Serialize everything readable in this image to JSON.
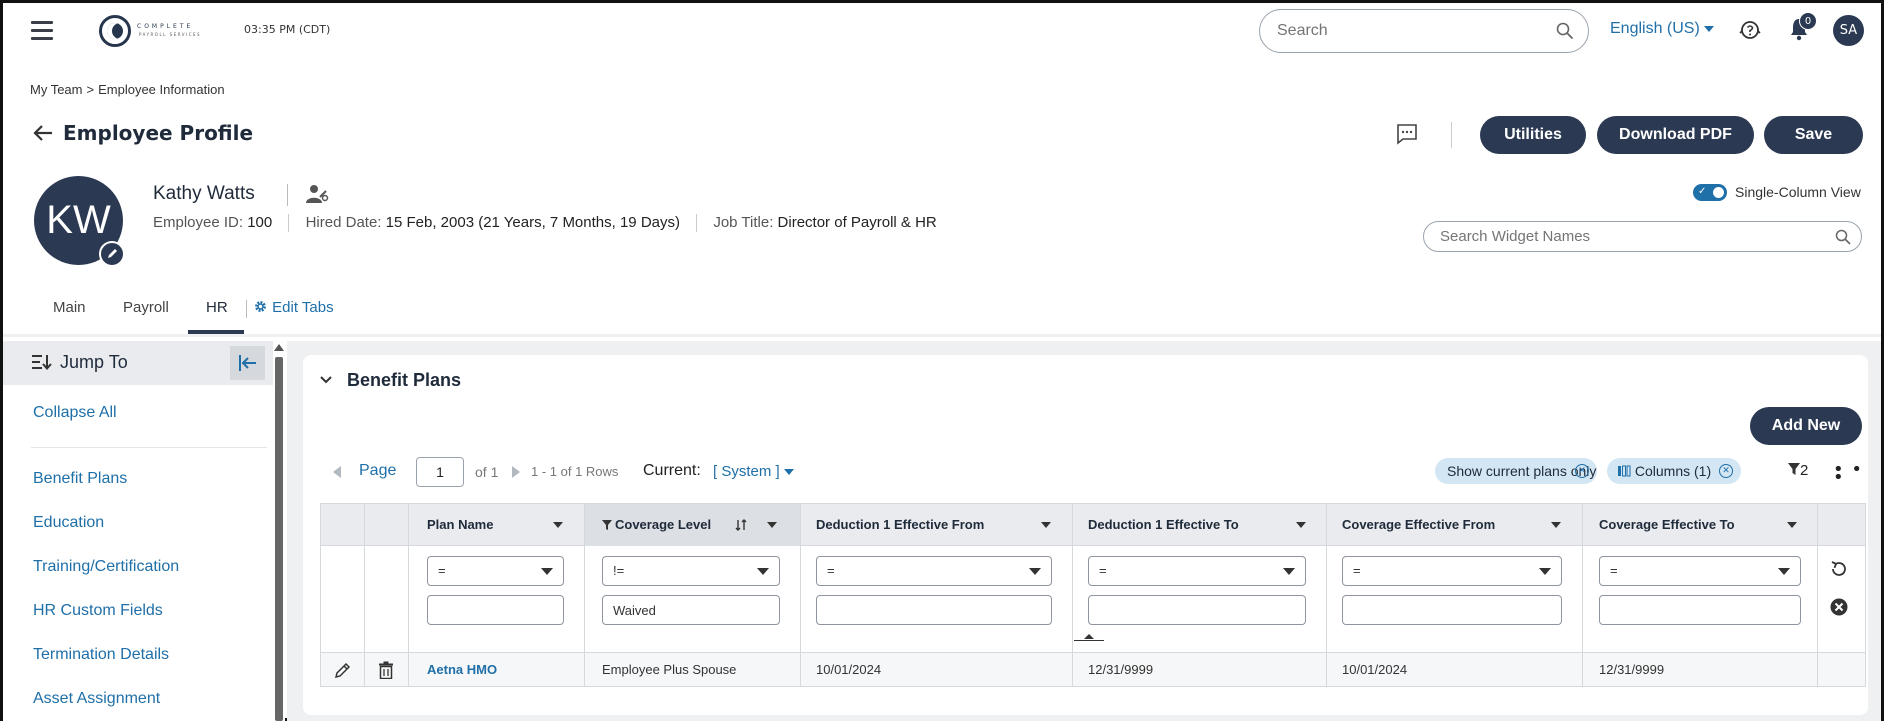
{
  "topbar": {
    "logo_line1": "COMPLETE",
    "logo_line2": "PAYROLL SERVICES",
    "time": "03:35 PM (CDT)",
    "search_placeholder": "Search",
    "language": "English (US)",
    "notification_count": "0",
    "user_initials": "SA"
  },
  "breadcrumb": {
    "parent": "My Team",
    "separator": ">",
    "current": "Employee Information"
  },
  "header": {
    "title": "Employee Profile",
    "utilities_label": "Utilities",
    "download_pdf_label": "Download PDF",
    "save_label": "Save"
  },
  "employee": {
    "initials": "KW",
    "name": "Kathy Watts",
    "id_label": "Employee ID:",
    "id_value": "100",
    "hired_label": "Hired Date:",
    "hired_value": "15 Feb, 2003 (21 Years, 7 Months, 19 Days)",
    "job_label": "Job Title:",
    "job_value": "Director of Payroll & HR"
  },
  "view_toggle": {
    "label": "Single-Column View",
    "on": true
  },
  "widget_search": {
    "placeholder": "Search Widget Names"
  },
  "tabs": [
    {
      "label": "Main"
    },
    {
      "label": "Payroll"
    },
    {
      "label": "HR",
      "active": true
    }
  ],
  "edit_tabs_label": "Edit Tabs",
  "sidebar": {
    "title": "Jump To",
    "collapse_all": "Collapse All",
    "items": [
      "Benefit Plans",
      "Education",
      "Training/Certification",
      "HR Custom Fields",
      "Termination Details",
      "Asset Assignment"
    ]
  },
  "benefit_plans": {
    "title": "Benefit Plans",
    "add_new_label": "Add New",
    "pager": {
      "page_label": "Page",
      "page_value": "1",
      "of_label": "of 1",
      "rows_label": "1 - 1 of 1 Rows"
    },
    "current_label": "Current:",
    "current_value": "[ System ]",
    "chips": {
      "show_current": "Show current plans only",
      "columns": "Columns (1)"
    },
    "filter_count": "2",
    "columns": [
      "Plan Name",
      "Coverage Level",
      "Deduction 1 Effective From",
      "Deduction 1 Effective To",
      "Coverage Effective From",
      "Coverage Effective To"
    ],
    "filter_operators": [
      "=",
      "!=",
      "=",
      "=",
      "=",
      "="
    ],
    "filter_values": [
      "",
      "Waived",
      "",
      "",
      "",
      ""
    ],
    "rows": [
      {
        "plan_name": "Aetna HMO",
        "coverage_level": "Employee Plus Spouse",
        "ded_from": "10/01/2024",
        "ded_to": "12/31/9999",
        "cov_from": "10/01/2024",
        "cov_to": "12/31/9999"
      }
    ]
  },
  "colors": {
    "navy": "#2b3a52",
    "link_blue": "#1f6fa8",
    "chip_bg": "#d3e6f3",
    "panel_gray": "#eef0f2"
  }
}
